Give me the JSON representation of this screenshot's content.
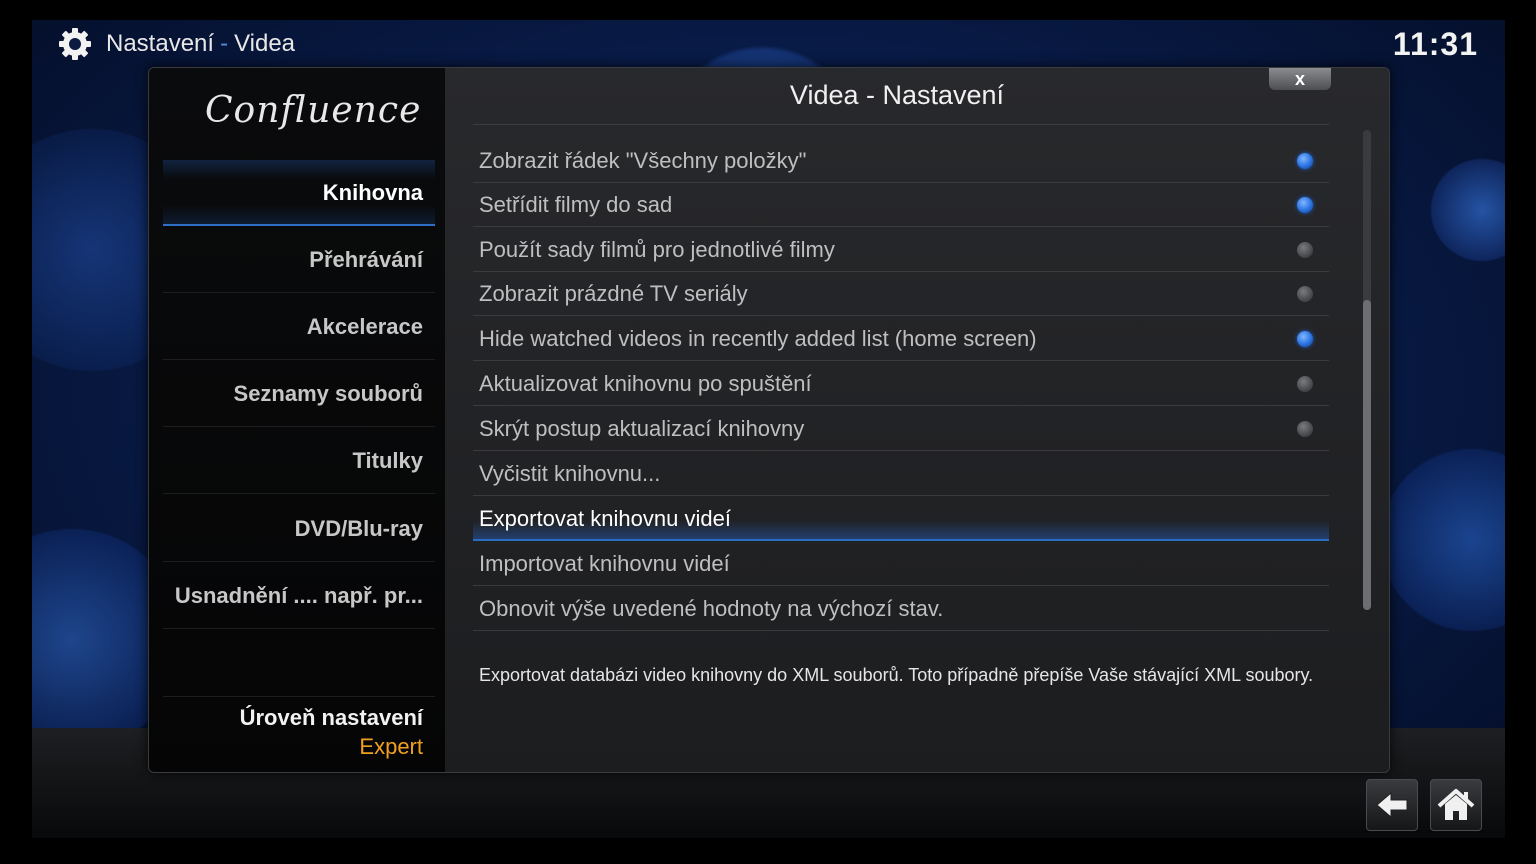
{
  "header": {
    "title": "Nastavení",
    "separator": "-",
    "subtitle": "Videa",
    "clock": "11:31"
  },
  "sidebar": {
    "brand": "Confluence",
    "categories": [
      {
        "label": "Knihovna",
        "active": true
      },
      {
        "label": "Přehrávání",
        "active": false
      },
      {
        "label": "Akcelerace",
        "active": false
      },
      {
        "label": "Seznamy souborů",
        "active": false
      },
      {
        "label": "Titulky",
        "active": false
      },
      {
        "label": "DVD/Blu-ray",
        "active": false
      },
      {
        "label": "Usnadnění .... např. pr...",
        "active": false
      }
    ],
    "level": {
      "label": "Úroveň nastavení",
      "value": "Expert"
    }
  },
  "dialog": {
    "title": "Videa - Nastavení",
    "close_label": "x",
    "settings": [
      {
        "label": "Zobrazit řádek \"Všechny položky\"",
        "type": "toggle",
        "value": true
      },
      {
        "label": "Setřídit filmy do sad",
        "type": "toggle",
        "value": true
      },
      {
        "label": "Použít sady filmů pro jednotlivé filmy",
        "type": "toggle",
        "value": false
      },
      {
        "label": "Zobrazit prázdné TV seriály",
        "type": "toggle",
        "value": false
      },
      {
        "label": "Hide watched videos in recently added list (home screen)",
        "type": "toggle",
        "value": true
      },
      {
        "label": "Aktualizovat knihovnu po spuštění",
        "type": "toggle",
        "value": false
      },
      {
        "label": "Skrýt postup aktualizací knihovny",
        "type": "toggle",
        "value": false
      },
      {
        "label": "Vyčistit knihovnu...",
        "type": "action"
      },
      {
        "label": "Exportovat knihovnu videí",
        "type": "action",
        "focused": true
      },
      {
        "label": "Importovat knihovnu videí",
        "type": "action"
      },
      {
        "label": "Obnovit výše uvedené hodnoty na výchozí stav.",
        "type": "action"
      }
    ],
    "description": "Exportovat databázi video knihovny do XML souborů. Toto případně přepíše Vaše stávající XML soubory."
  },
  "colors": {
    "accent": "#2a6cc2",
    "level_value": "#f0a020",
    "radio_on": "#2a72e0"
  },
  "icons": {
    "header": "settings-gear-icon",
    "back": "back-arrow-icon",
    "home": "home-icon"
  }
}
